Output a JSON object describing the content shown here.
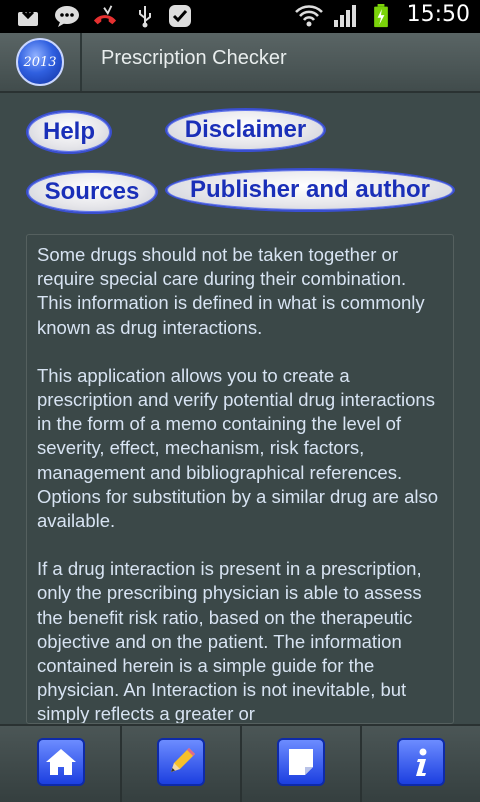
{
  "status_bar": {
    "time": "15:50",
    "icons": [
      "download-icon",
      "chat-icon",
      "missed-call-icon",
      "usb-icon",
      "check-icon",
      "wifi-icon",
      "signal-icon",
      "battery-charging-icon"
    ]
  },
  "app": {
    "logo_text": "2013",
    "title": "Prescription Checker"
  },
  "buttons": {
    "help": "Help",
    "disclaimer": "Disclaimer",
    "sources": "Sources",
    "publisher": "Publisher and author"
  },
  "content": {
    "paragraphs": [
      "Some drugs should not be taken together or require special care during their combination. This information is defined in what is commonly known as drug interactions.",
      "This application allows you to create a prescription and verify potential drug interactions in the form of a memo containing the level of severity, effect, mechanism, risk factors, management and bibliographical references. Options for substitution by a similar drug are also available.",
      "If a drug interaction is present in a prescription, only the prescribing physician is able to assess the benefit risk ratio, based on the therapeutic objective and on the patient. The information contained herein is a simple guide for the physician. An Interaction is not inevitable, but simply reflects a greater or"
    ]
  },
  "bottom_nav": {
    "items": [
      "home-icon",
      "pencil-icon",
      "note-icon",
      "info-icon"
    ]
  }
}
